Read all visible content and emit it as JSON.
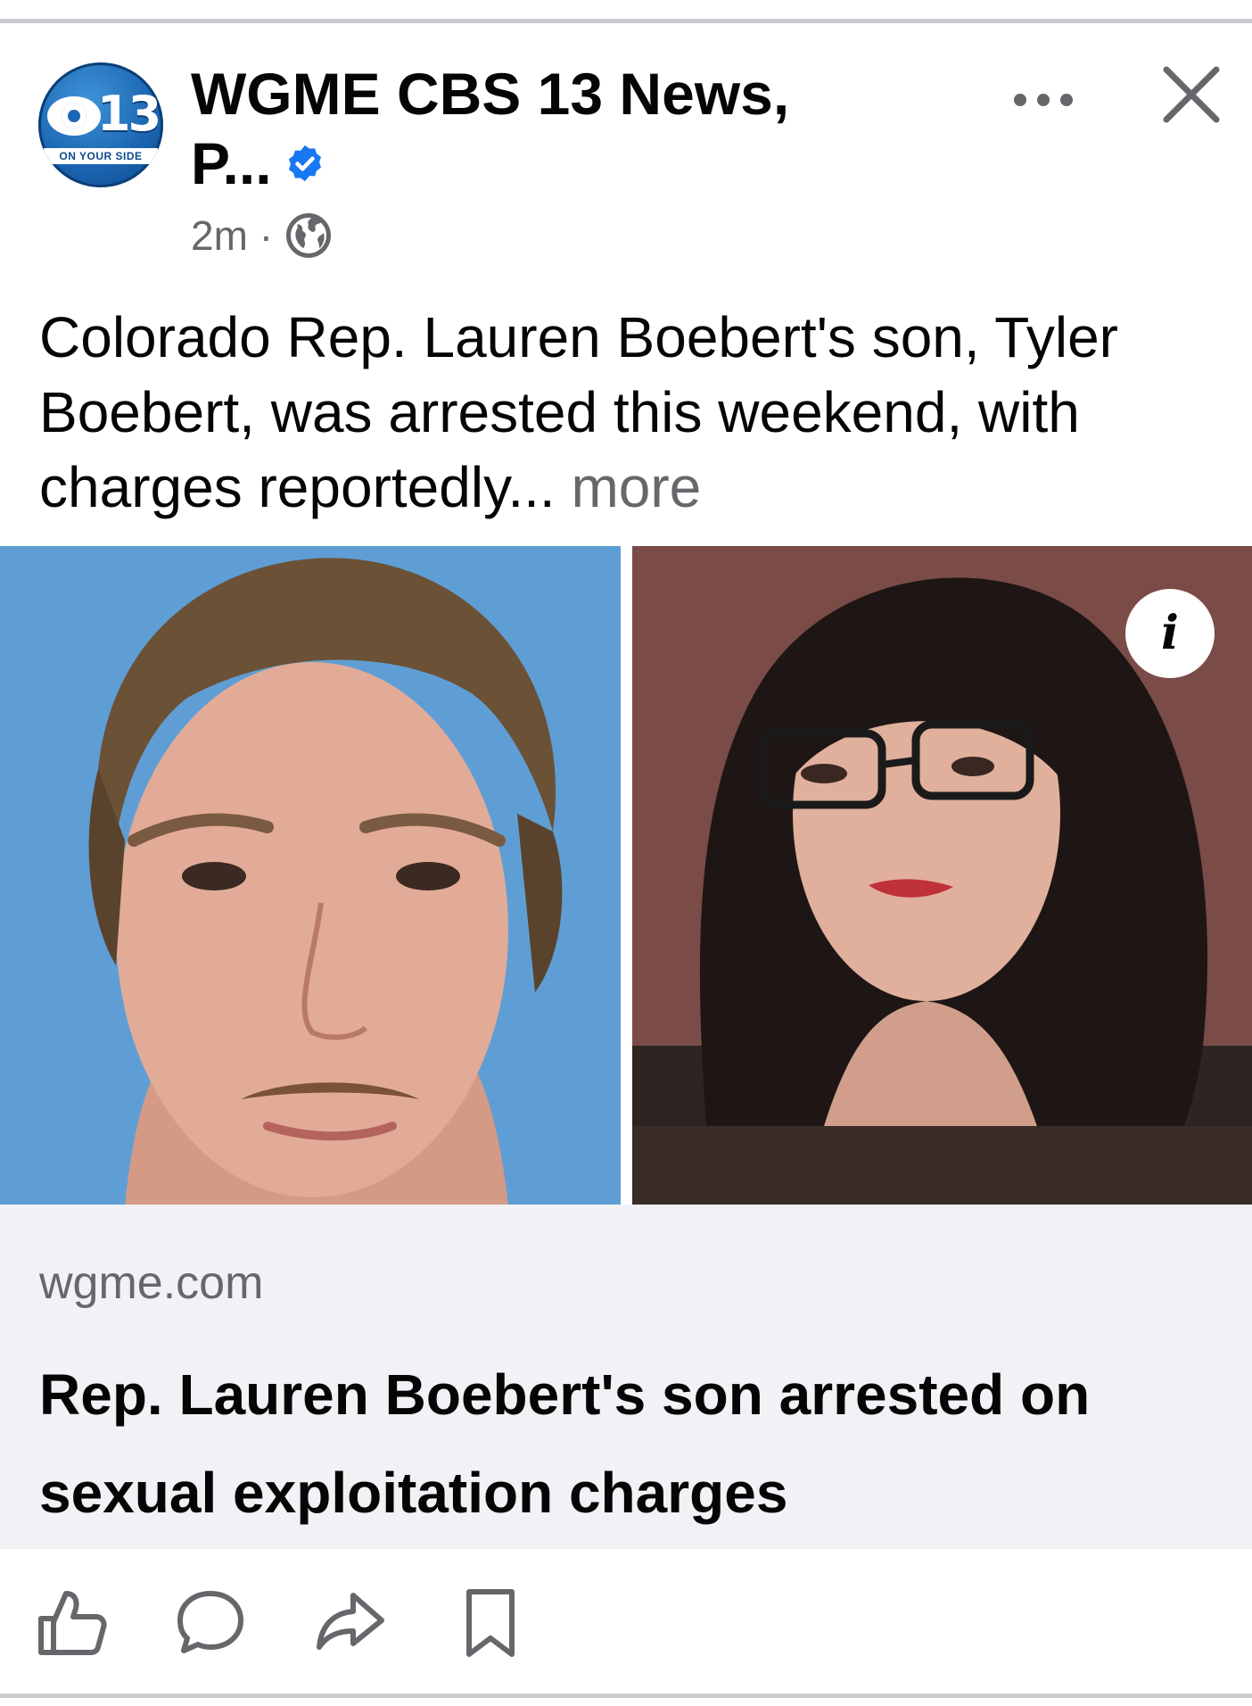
{
  "post": {
    "page_name": "WGME CBS 13 News,\nP...",
    "logo_number": "13",
    "logo_tagline": "ON YOUR SIDE",
    "timestamp": "2m",
    "separator": "·",
    "caption": "Colorado Rep. Lauren Boebert's son, Tyler Boebert, was arrested this weekend, with charges reportedly...",
    "see_more": "more"
  },
  "icons": {
    "verified": "verified-badge-icon",
    "privacy": "globe-icon",
    "options": "more-options-icon",
    "close": "close-icon",
    "info": "info-icon",
    "like": "like-icon",
    "comment": "comment-icon",
    "share": "share-icon",
    "save": "bookmark-icon"
  },
  "info_button": "i",
  "link": {
    "domain": "wgme.com",
    "headline": "Rep. Lauren Boebert's son arrested on sexual exploitation charges"
  },
  "colors": {
    "verified": "#1877f2",
    "secondary_text": "#65676b",
    "card_background": "#f0f2f5"
  }
}
